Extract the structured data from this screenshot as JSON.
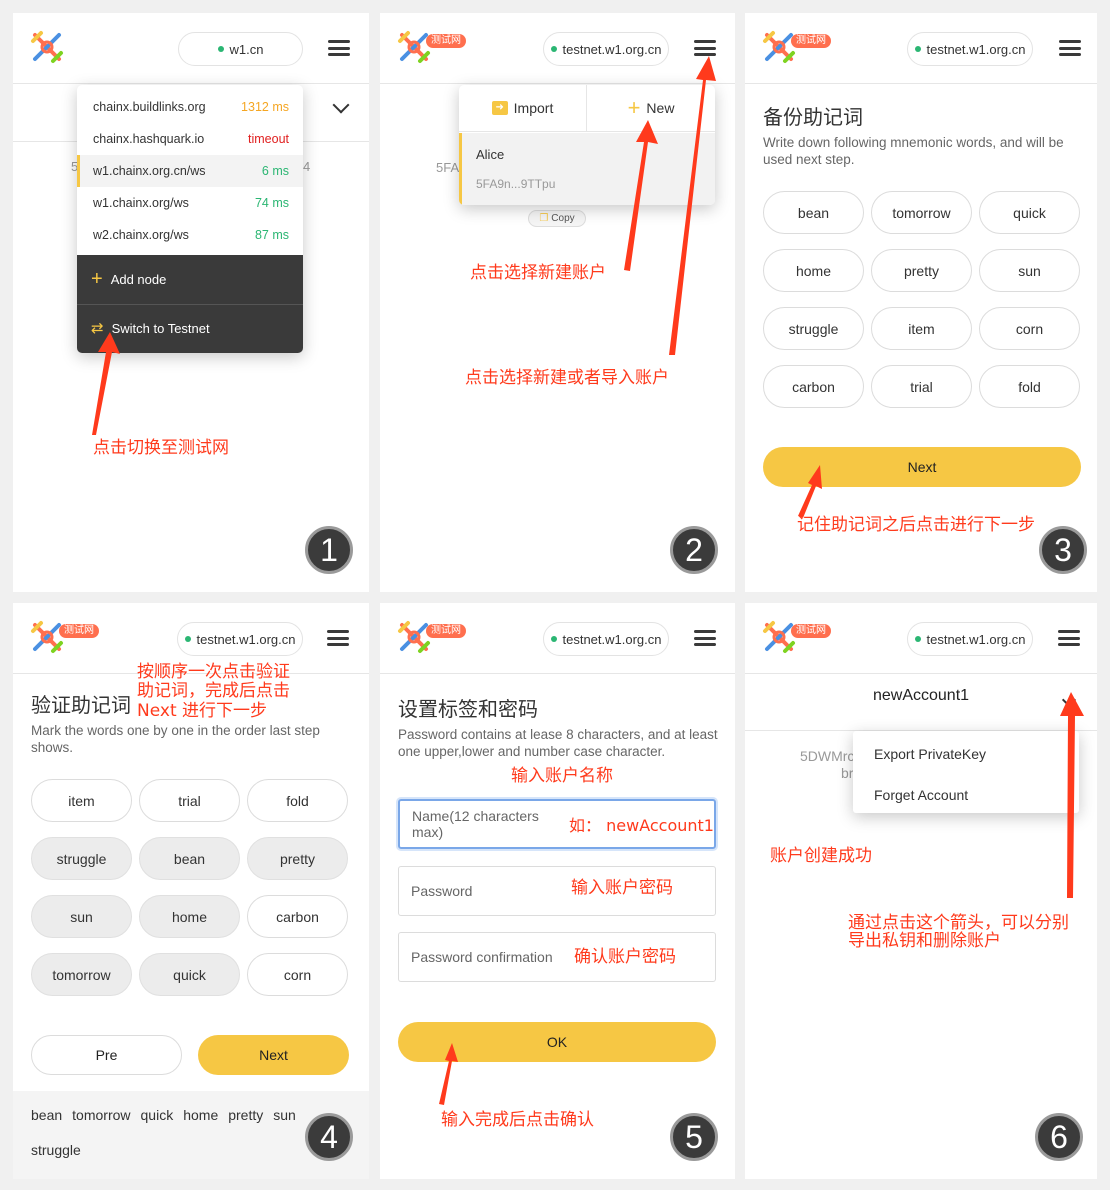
{
  "colors": {
    "accent": "#f6c744",
    "annotation": "#ff3a1c",
    "dark_menu": "#3a3a3a",
    "ok_green": "#2bb673",
    "warn_orange": "#f5a623",
    "timeout_red": "#e02020",
    "testnet_badge": "#ff6f4e"
  },
  "icons": [
    "logo-icon",
    "hamburger-menu-icon",
    "chevron-down-icon",
    "plus-icon",
    "swap-icon",
    "import-icon",
    "copy-icon",
    "arrow-icon"
  ],
  "common": {
    "testnet_badge": "测试网",
    "testnet_node": "testnet.w1.org.cn"
  },
  "p1": {
    "node": "w1.cn",
    "step": "1",
    "behind_left": "5",
    "behind_right": "4",
    "nodes": [
      {
        "name": "chainx.buildlinks.org",
        "latency": "1312 ms",
        "status": "warn"
      },
      {
        "name": "chainx.hashquark.io",
        "latency": "timeout",
        "status": "bad"
      },
      {
        "name": "w1.chainx.org.cn/ws",
        "latency": "6 ms",
        "status": "good",
        "selected": true
      },
      {
        "name": "w1.chainx.org/ws",
        "latency": "74 ms",
        "status": "good"
      },
      {
        "name": "w2.chainx.org/ws",
        "latency": "87 ms",
        "status": "good"
      }
    ],
    "add_node": "Add node",
    "switch_testnet": "Switch to Testnet",
    "annotation": "点击切换至测试网"
  },
  "p2": {
    "step": "2",
    "import": "Import",
    "new": "New",
    "account_name": "Alice",
    "account_addr": "5FA9n...9TTpu",
    "behind_addr": "5FA",
    "copy": "Copy",
    "annotation_new": "点击选择新建账户",
    "annotation_menu": "点击选择新建或者导入账户"
  },
  "p3": {
    "step": "3",
    "title": "备份助记词",
    "desc": "Write down following mnemonic words, and will be used next step.",
    "words": [
      "bean",
      "tomorrow",
      "quick",
      "home",
      "pretty",
      "sun",
      "struggle",
      "item",
      "corn",
      "carbon",
      "trial",
      "fold"
    ],
    "next": "Next",
    "annotation": "记住助记词之后点击进行下一步"
  },
  "p4": {
    "step": "4",
    "title": "验证助记词",
    "desc": "Mark the words one by one in the order last step shows.",
    "words": [
      "item",
      "trial",
      "fold",
      "struggle",
      "bean",
      "pretty",
      "sun",
      "home",
      "carbon",
      "tomorrow",
      "quick",
      "corn"
    ],
    "pre": "Pre",
    "next": "Next",
    "selected": [
      "bean",
      "tomorrow",
      "quick",
      "home",
      "pretty",
      "sun",
      "struggle"
    ],
    "annotation_l1": "按顺序一次点击验证",
    "annotation_l2": "助记词，完成后点击",
    "annotation_l3": "Next 进行下一步"
  },
  "p5": {
    "step": "5",
    "title": "设置标签和密码",
    "desc": "Password contains at lease 8 characters, and at least one upper,lower and number case character.",
    "name_placeholder": "Name(12 characters max)",
    "name_example": "如： newAccount1",
    "password": "Password",
    "password_confirm": "Password confirmation",
    "ok": "OK",
    "ann_name": "输入账户名称",
    "ann_pwd": "输入账户密码",
    "ann_confirm": "确认账户密码",
    "ann_ok": "输入完成后点击确认"
  },
  "p6": {
    "step": "6",
    "account": "newAccount1",
    "behind_addr": "5DWMrc",
    "behind_line2": "br",
    "export": "Export PrivateKey",
    "forget": "Forget Account",
    "ann_success": "账户创建成功",
    "ann_arrow_l1": "通过点击这个箭头，可以分别",
    "ann_arrow_l2": "导出私钥和删除账户"
  }
}
